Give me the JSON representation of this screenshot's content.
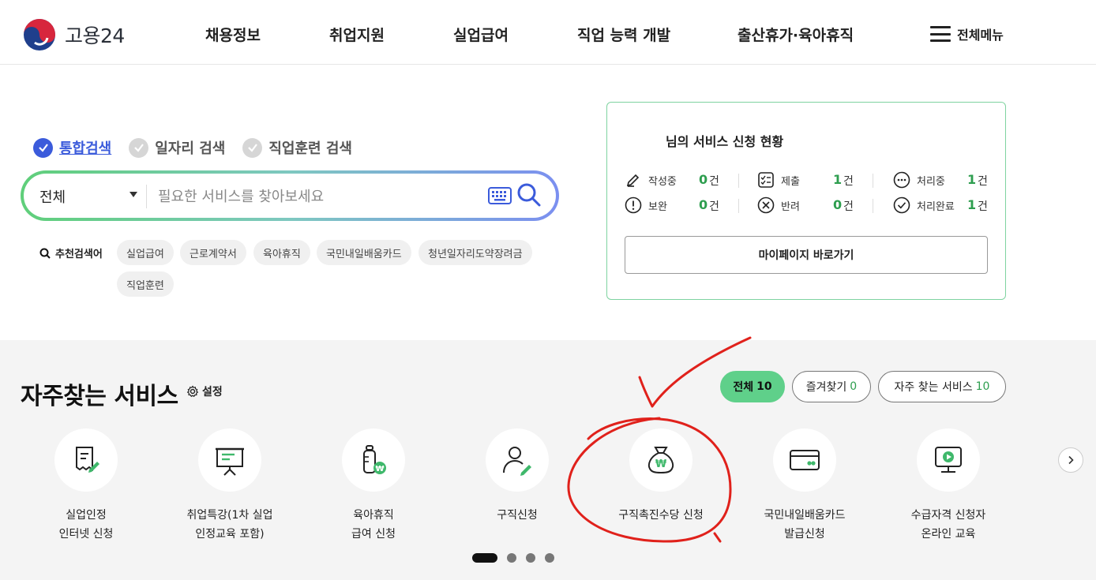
{
  "header": {
    "logo_text": "고용24",
    "nav": [
      "채용정보",
      "취업지원",
      "실업급여",
      "직업 능력 개발",
      "출산휴가·육아휴직"
    ],
    "all_menu_label": "전체메뉴"
  },
  "search": {
    "tabs": [
      {
        "label": "통합검색",
        "active": true
      },
      {
        "label": "일자리 검색",
        "active": false
      },
      {
        "label": "직업훈련 검색",
        "active": false
      }
    ],
    "select_value": "전체",
    "placeholder": "필요한 서비스를 찾아보세요",
    "recommended_label": "추천검색어",
    "recommended": [
      "실업급여",
      "근로계약서",
      "육아휴직",
      "국민내일배움카드",
      "청년일자리도약장려금",
      "직업훈련"
    ]
  },
  "status": {
    "title": "님의 서비스 신청 현황",
    "items": [
      {
        "label": "작성중",
        "value": "0",
        "unit": "건",
        "icon": "pencil-icon"
      },
      {
        "label": "제출",
        "value": "1",
        "unit": "건",
        "icon": "checklist-icon"
      },
      {
        "label": "처리중",
        "value": "1",
        "unit": "건",
        "icon": "ellipsis-icon"
      },
      {
        "label": "보완",
        "value": "0",
        "unit": "건",
        "icon": "alert-icon"
      },
      {
        "label": "반려",
        "value": "0",
        "unit": "건",
        "icon": "x-circle-icon"
      },
      {
        "label": "처리완료",
        "value": "1",
        "unit": "건",
        "icon": "check-circle-icon"
      }
    ],
    "mypage_button": "마이페이지 바로가기"
  },
  "frequent": {
    "title": "자주찾는 서비스",
    "settings_label": "설정",
    "tabs": [
      {
        "label": "전체",
        "count": "10",
        "active": true
      },
      {
        "label": "즐겨찾기",
        "count": "0",
        "active": false
      },
      {
        "label": "자주 찾는 서비스",
        "count": "10",
        "active": false
      }
    ],
    "services": [
      {
        "label": "실업인정\n인터넷 신청",
        "icon": "receipt-pen-icon"
      },
      {
        "label": "취업특강(1차 실업\n인정교육 포함)",
        "icon": "presentation-board-icon"
      },
      {
        "label": "육아휴직\n급여 신청",
        "icon": "baby-bottle-won-icon"
      },
      {
        "label": "구직신청",
        "icon": "person-pen-icon"
      },
      {
        "label": "구직촉진수당 신청",
        "icon": "money-bag-won-icon"
      },
      {
        "label": "국민내일배움카드\n발급신청",
        "icon": "card-icon"
      },
      {
        "label": "수급자격 신청자\n온라인 교육",
        "icon": "monitor-play-icon"
      }
    ],
    "pagination_count": 4,
    "pagination_active": 1
  },
  "colors": {
    "accent_green": "#5fd08a",
    "value_green": "#2e9e4f",
    "accent_blue": "#3b5bdb",
    "annotation_red": "#e0211b"
  }
}
